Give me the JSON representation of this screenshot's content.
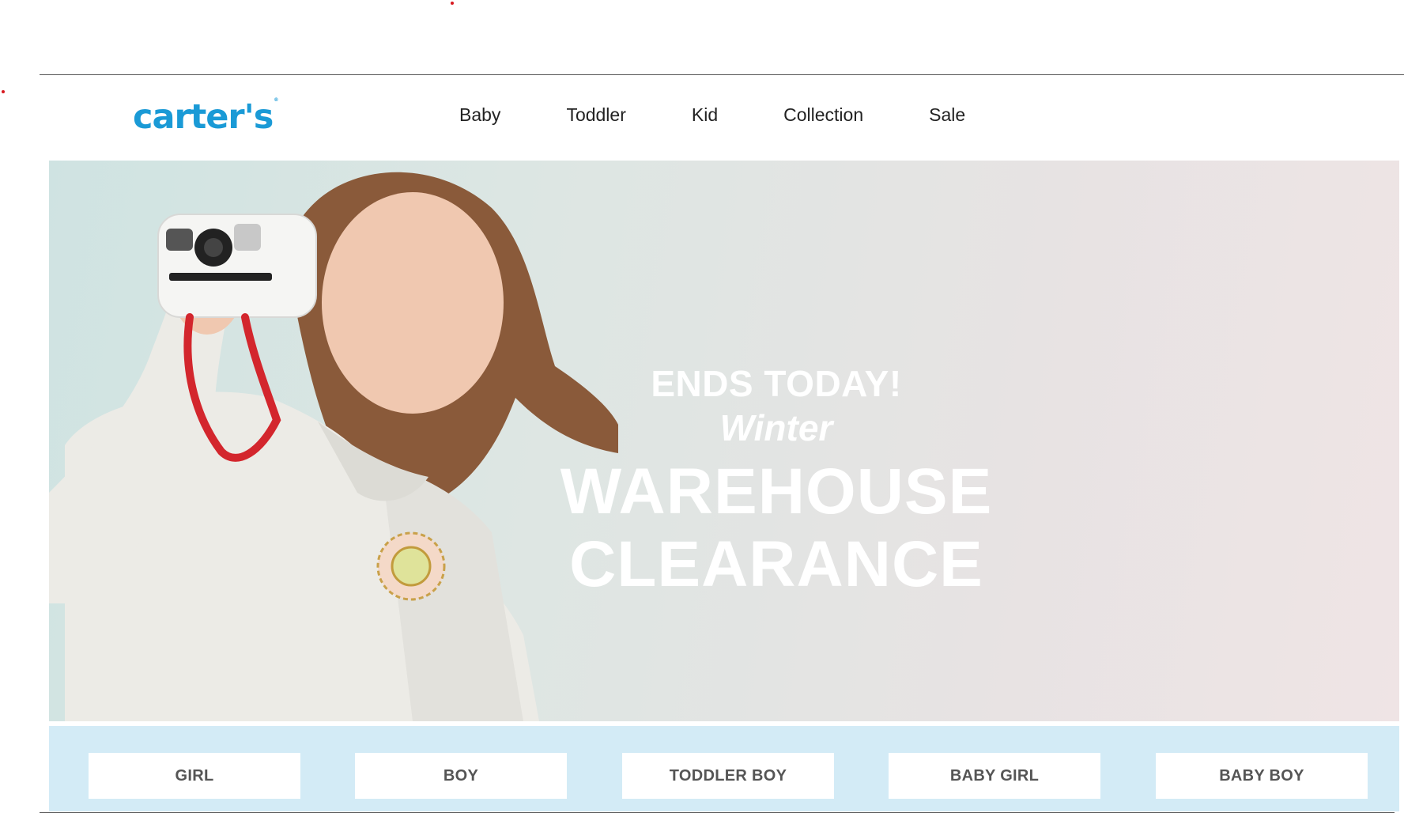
{
  "header": {
    "logo": "carter's",
    "logo_tm": "®",
    "nav": [
      "Baby",
      "Toddler",
      "Kid",
      "Collection",
      "Sale"
    ]
  },
  "hero": {
    "line1": "ENDS TODAY!",
    "line2": "Winter",
    "line3": "WAREHOUSE",
    "line4": "CLEARANCE"
  },
  "categories": [
    "GIRL",
    "BOY",
    "TODDLER BOY",
    "BABY GIRL",
    "BABY BOY"
  ],
  "colors": {
    "brand": "#1a9ad6",
    "category_band": "#d3ebf6",
    "category_text": "#555555"
  }
}
